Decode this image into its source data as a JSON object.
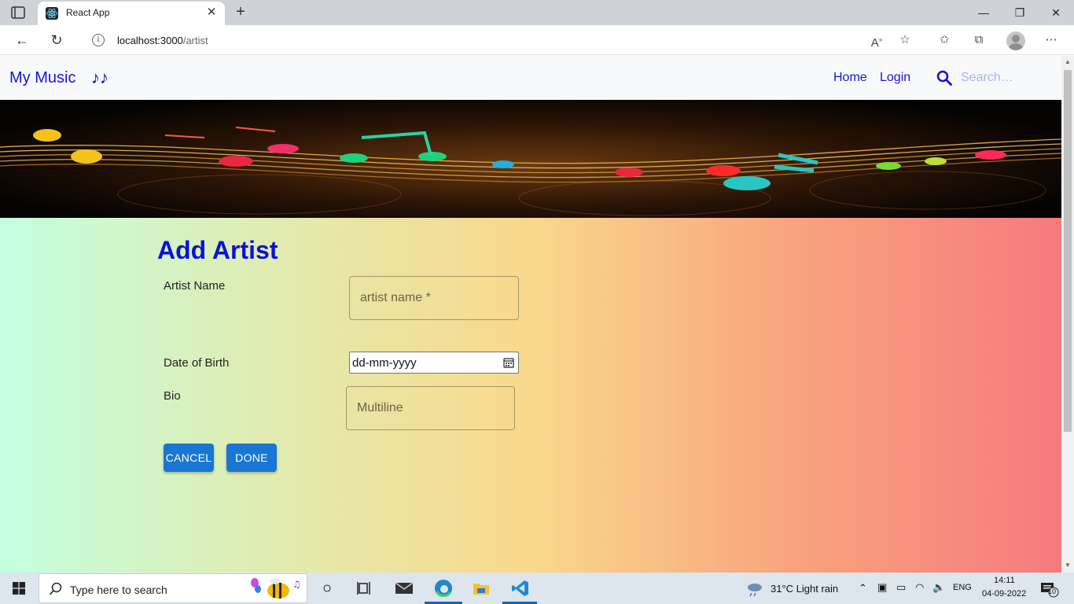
{
  "browser": {
    "tab_title": "React App",
    "url_host": "localhost:3000",
    "url_path": "/artist",
    "colors": {
      "tabbar": "#cfd3d7",
      "active_tab": "#ffffff"
    }
  },
  "navbar": {
    "brand": "My Music",
    "brand_icon": "music-notes-icon",
    "links": [
      "Home",
      "Login"
    ],
    "search_placeholder": "Search…"
  },
  "form": {
    "title": "Add Artist",
    "artist_name_label": "Artist Name",
    "artist_name_placeholder": "artist name *",
    "dob_label": "Date of Birth",
    "dob_value": "dd-mm-yyyy",
    "bio_label": "Bio",
    "bio_placeholder": "Multiline",
    "cancel_label": "CANCEL",
    "done_label": "DONE",
    "colors": {
      "title": "#0a12d8",
      "button": "#1976d2"
    }
  },
  "taskbar": {
    "search_text": "Type here to search",
    "weather": "31°C  Light rain",
    "language": "ENG",
    "time": "14:11",
    "date": "04-09-2022",
    "notifications": "10"
  }
}
